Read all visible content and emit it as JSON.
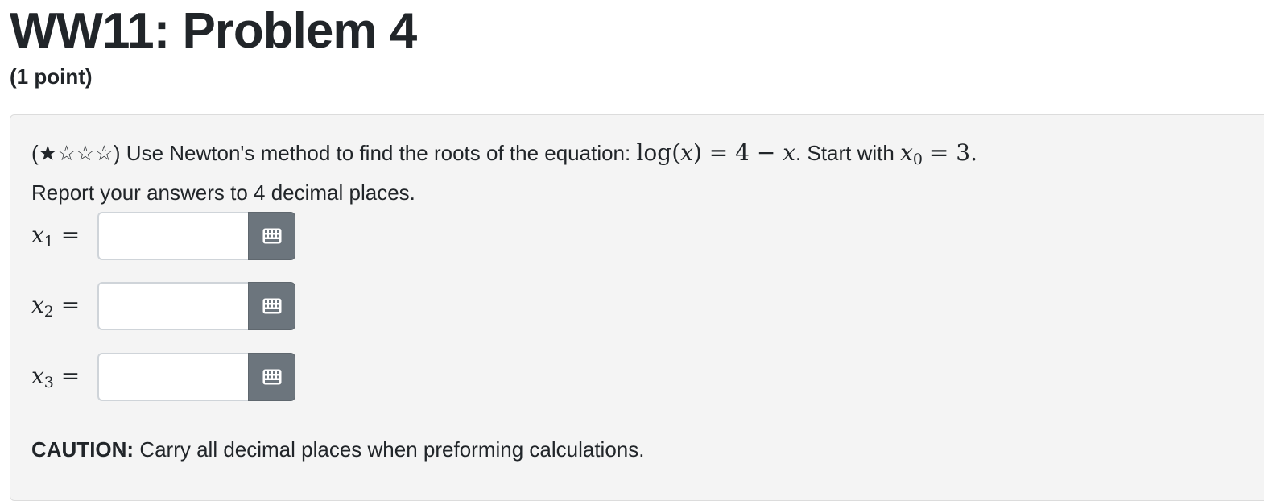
{
  "header": {
    "title": "WW11: Problem 4",
    "points": "(1 point)"
  },
  "problem": {
    "stars": "(★☆☆☆)",
    "intro": " Use Newton's method to find the roots of the equation: ",
    "equation_fn": "log",
    "equation_arg": "x",
    "equation_rhs_const": "4",
    "equation_rhs_var": "x",
    "start_text": ". Start with ",
    "x0_var": "x",
    "x0_sub": "0",
    "x0_value": "3",
    "end_period": ".",
    "line2": "Report your answers to 4 decimal places."
  },
  "answers": [
    {
      "var": "x",
      "sub": "1",
      "value": "",
      "placeholder": ""
    },
    {
      "var": "x",
      "sub": "2",
      "value": "",
      "placeholder": ""
    },
    {
      "var": "x",
      "sub": "3",
      "value": "",
      "placeholder": ""
    }
  ],
  "keypad_icon": "calculator-grid-icon",
  "caution": {
    "label": "CAUTION:",
    "text": " Carry all decimal places when preforming calculations."
  },
  "colors": {
    "panel_bg": "#f4f4f4",
    "button_bg": "#6c757d",
    "text": "#212529"
  }
}
